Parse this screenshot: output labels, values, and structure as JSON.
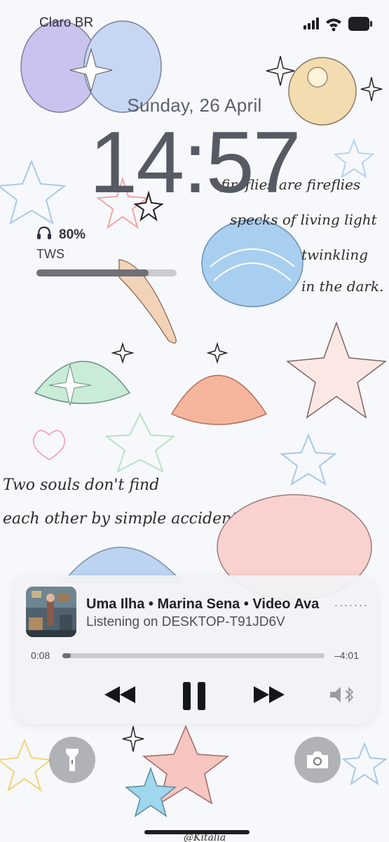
{
  "status": {
    "carrier": "Claro BR"
  },
  "lock": {
    "date": "Sunday, 26 April",
    "time": "14:57"
  },
  "widget": {
    "battery_pct": "80%",
    "device": "TWS",
    "level": 0.8
  },
  "wall_text": {
    "line1a": "Two souls don't find",
    "line1b": "each other by simple accident.",
    "poem1": "fireflies are fireflies",
    "poem2": "specks of living light",
    "poem3": "twinkling",
    "poem4": "in the dark.",
    "signature": "@Kitalia"
  },
  "player": {
    "title": "Uma Ilha • Marina Sena • Video Ava",
    "subtitle": "Listening on DESKTOP-T91JD6V",
    "elapsed": "0:08",
    "remaining": "–4:01",
    "progress": 0.032
  },
  "icons": [
    "flashlight-icon",
    "camera-icon",
    "rewind-icon",
    "pause-icon",
    "forward-icon",
    "speaker-bluetooth-icon",
    "headphones-icon",
    "wifi-icon",
    "cellular-icon",
    "battery-icon"
  ]
}
